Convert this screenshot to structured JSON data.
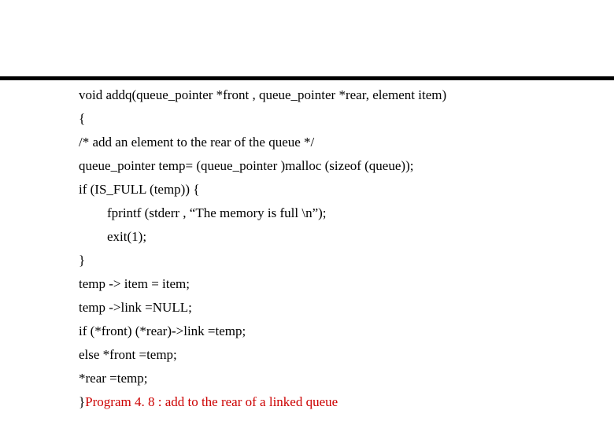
{
  "code": {
    "line1": "void addq(queue_pointer *front , queue_pointer *rear, element item)",
    "line2": "{",
    "line3": "/* add an element to the rear of the queue */",
    "line4": "queue_pointer temp= (queue_pointer )malloc (sizeof (queue));",
    "line5": "if (IS_FULL (temp)) {",
    "line6": "fprintf (stderr , “The memory is full \\n”);",
    "line7": "exit(1);",
    "line8": "}",
    "line9": "temp -> item = item;",
    "line10": "temp ->link =NULL;",
    "line11": "if (*front) (*rear)->link =temp;",
    "line12": "else *front =temp;",
    "line13": "*rear =temp;",
    "line14": "}",
    "caption": "Program 4. 8 : add to the rear of a linked queue"
  }
}
